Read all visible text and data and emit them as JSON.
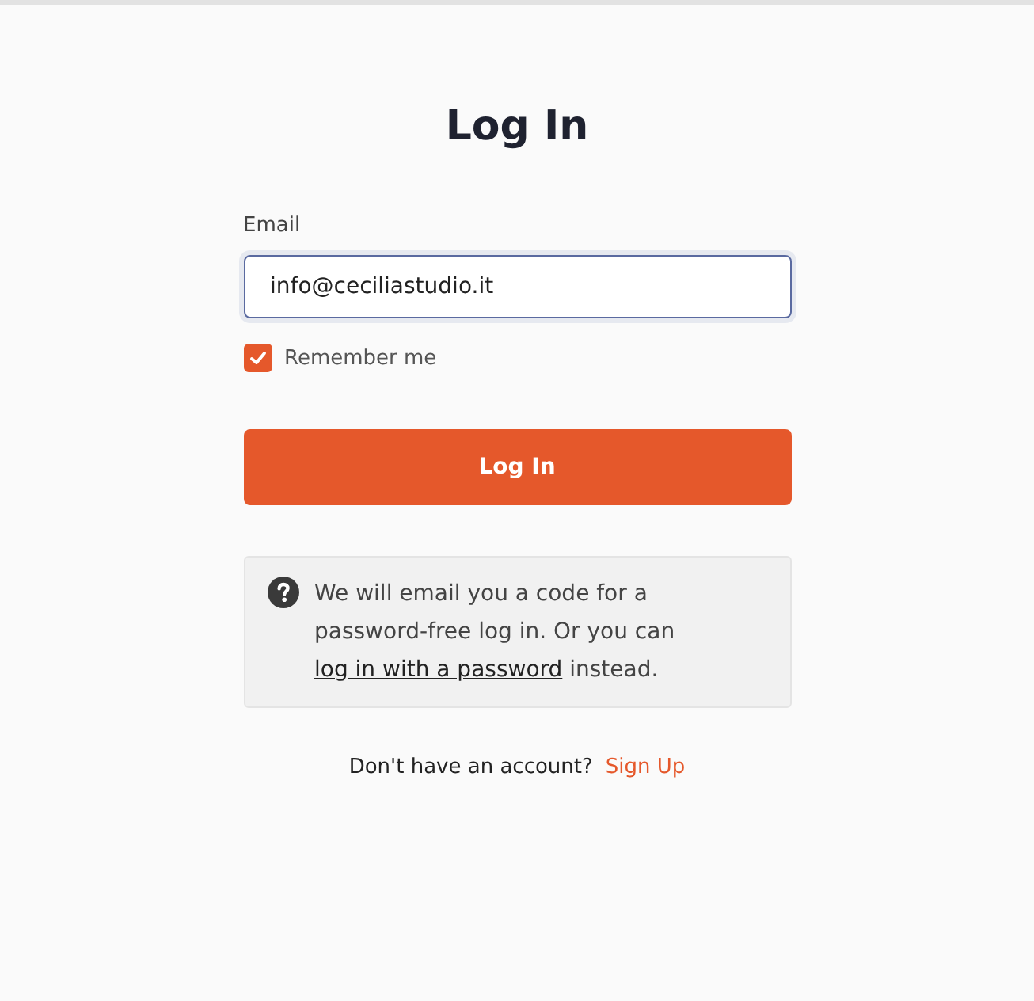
{
  "title": "Log In",
  "email": {
    "label": "Email",
    "value": "info@ceciliastudio.it"
  },
  "remember": {
    "label": "Remember me",
    "checked": true
  },
  "submit": {
    "label": "Log In"
  },
  "info": {
    "text_before": "We will email you a code for a password-free log in. Or you can",
    "link": "log in with a password",
    "text_after": "instead."
  },
  "signup": {
    "prompt": "Don't have an account?",
    "link": "Sign Up"
  }
}
